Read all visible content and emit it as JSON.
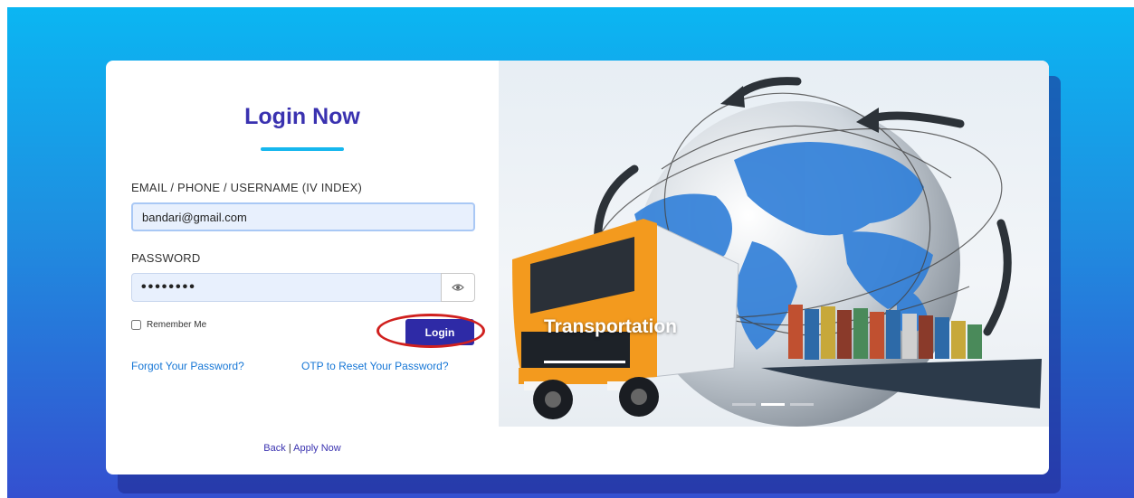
{
  "login": {
    "title": "Login Now",
    "email_label": "EMAIL / PHONE / USERNAME (IV INDEX)",
    "email_value": "bandari@gmail.com",
    "password_label": "PASSWORD",
    "password_value": "••••••••",
    "remember_label": "Remember Me",
    "login_button": "Login",
    "forgot_link": "Forgot Your Password?",
    "otp_link": "OTP to Reset Your Password?",
    "back_link": "Back",
    "separator": "|",
    "apply_link": "Apply Now"
  },
  "slider": {
    "caption": "Transportation",
    "slide_count": 3,
    "active_index": 1
  },
  "icons": {
    "password_toggle": "eye-icon"
  },
  "colors": {
    "accent": "#3a32b0",
    "link": "#1777d6",
    "highlight": "#d0201e",
    "background_top": "#0bb6f2",
    "background_bottom": "#3450d0"
  }
}
